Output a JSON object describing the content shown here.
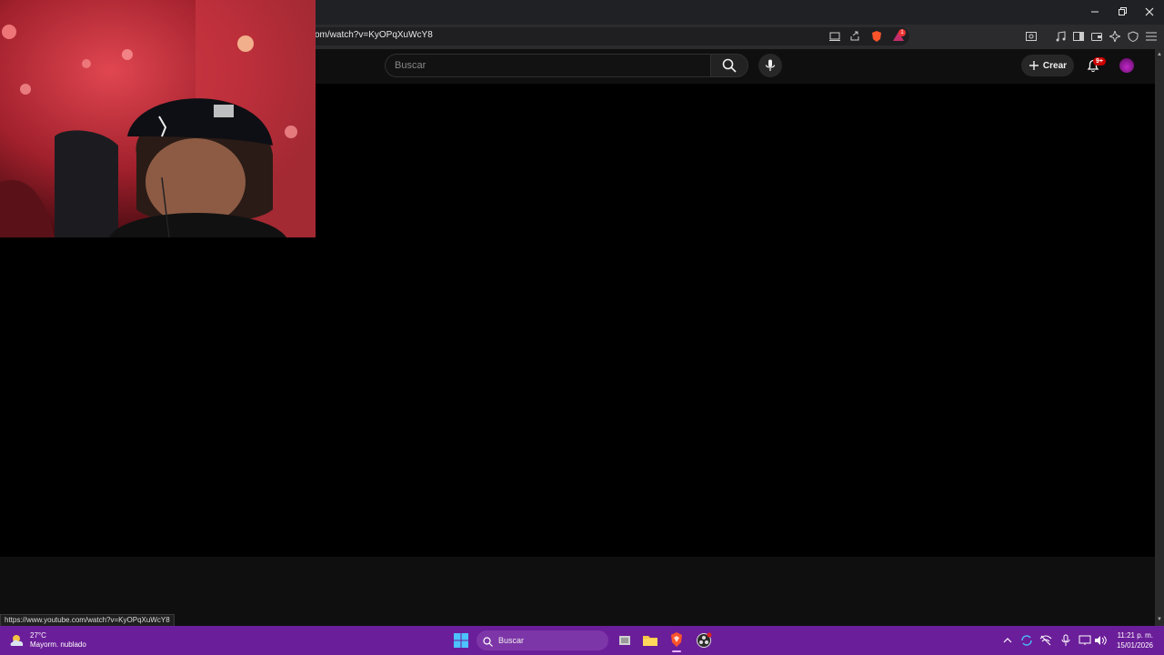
{
  "browser": {
    "url_text": "om/watch?v=KyOPqXuWcY8",
    "status_url": "https://www.youtube.com/watch?v=KyOPqXuWcY8",
    "window_controls": [
      "minimize-icon",
      "restore-icon",
      "close-icon"
    ],
    "brave_badge": "1"
  },
  "youtube": {
    "search_placeholder": "Buscar",
    "create_label": "Crear",
    "notification_badge": "9+"
  },
  "taskbar": {
    "weather_temp": "27°C",
    "weather_desc": "Mayorm. nublado",
    "search_label": "Buscar",
    "clock_time": "11:21 p. m.",
    "clock_date": "15/01/2026",
    "accent": "#6b1e99"
  }
}
